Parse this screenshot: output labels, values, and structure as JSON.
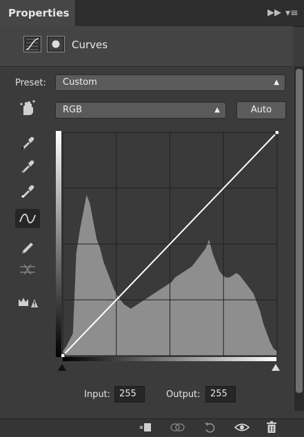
{
  "panel": {
    "tab_title": "Properties",
    "expand_icon": "double-chevron-right-icon",
    "menu_icon": "panel-menu-icon"
  },
  "header": {
    "title": "Curves",
    "adjustment_icon": "curves-adjustment-icon",
    "mask_icon": "layer-mask-icon"
  },
  "preset": {
    "label": "Preset:",
    "value": "Custom"
  },
  "channel": {
    "value": "RGB"
  },
  "auto_button": {
    "label": "Auto"
  },
  "tools": [
    "on-image-adjust-icon",
    "black-point-eyedropper-icon",
    "gray-point-eyedropper-icon",
    "white-point-eyedropper-icon",
    "curve-points-icon",
    "pencil-draw-icon",
    "smooth-curve-icon",
    "clipping-warning-icon"
  ],
  "active_tool": "curve-points-icon",
  "curve": {
    "points": [
      {
        "input": 0,
        "output": 0
      },
      {
        "input": 255,
        "output": 255
      }
    ],
    "grid_divisions": 4,
    "histogram_profile": [
      0.02,
      0.04,
      0.07,
      0.1,
      0.46,
      0.56,
      0.64,
      0.72,
      0.68,
      0.6,
      0.52,
      0.48,
      0.42,
      0.38,
      0.34,
      0.3,
      0.27,
      0.25,
      0.23,
      0.22,
      0.21,
      0.22,
      0.23,
      0.24,
      0.25,
      0.26,
      0.27,
      0.28,
      0.29,
      0.3,
      0.31,
      0.32,
      0.33,
      0.35,
      0.36,
      0.37,
      0.38,
      0.39,
      0.4,
      0.42,
      0.44,
      0.46,
      0.48,
      0.52,
      0.46,
      0.42,
      0.38,
      0.36,
      0.35,
      0.35,
      0.36,
      0.37,
      0.36,
      0.34,
      0.32,
      0.3,
      0.28,
      0.24,
      0.2,
      0.14,
      0.1,
      0.06,
      0.03,
      0.02
    ]
  },
  "input": {
    "label": "Input:",
    "value": "255"
  },
  "output": {
    "label": "Output:",
    "value": "255"
  },
  "footer_icons": [
    "clip-to-layer-icon",
    "view-previous-state-icon",
    "reset-icon",
    "toggle-visibility-icon",
    "delete-icon"
  ],
  "colors": {
    "panel_bg": "#3b3b3b",
    "graph_bg": "#3a3a3a",
    "histogram": "#8e8e8e",
    "curve": "#ffffff"
  }
}
